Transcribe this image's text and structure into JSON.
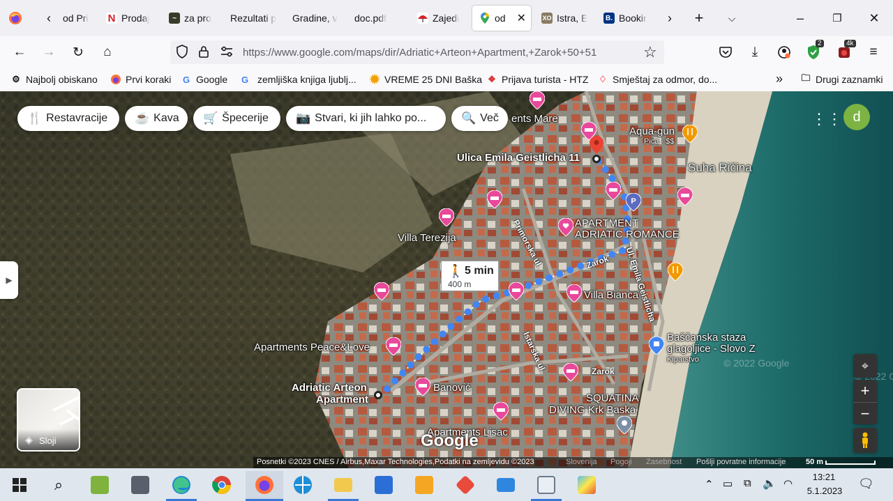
{
  "browser": {
    "tabs": [
      {
        "label": "od Pri"
      },
      {
        "label": "Prodaj"
      },
      {
        "label": "za pro"
      },
      {
        "label": "Rezultati p"
      },
      {
        "label": "Gradine, v"
      },
      {
        "label": "doc.pdf"
      },
      {
        "label": "Zajedi"
      },
      {
        "label": "od",
        "active": true
      },
      {
        "label": "Istra, E"
      },
      {
        "label": "Bookir"
      }
    ],
    "url": "https://www.google.com/maps/dir/Adriatic+Arteon+Apartment,+Zarok+50+51",
    "badges": {
      "vpn": "2",
      "ext": "4k"
    },
    "bookmarks": [
      {
        "label": "Najbolj obiskano"
      },
      {
        "label": "Prvi koraki"
      },
      {
        "label": "Google"
      },
      {
        "label": "zemljiška knjiga ljublj..."
      },
      {
        "label": "VREME 25 DNI Baška"
      },
      {
        "label": "Prijava turista - HTZ"
      },
      {
        "label": "Smještaj za odmor, do..."
      }
    ],
    "other_bookmarks": "Drugi zaznamki"
  },
  "map": {
    "chips": [
      {
        "label": "Restavracije"
      },
      {
        "label": "Kava"
      },
      {
        "label": "Špecerije"
      },
      {
        "label": "Stvari, ki jih lahko po..."
      },
      {
        "label": "Več"
      }
    ],
    "account_initial": "d",
    "route": {
      "duration": "5 min",
      "distance": "400 m"
    },
    "places": {
      "destination": "Ulica Emila Geistlicha 11",
      "origin_line1": "Adriatic Arteon",
      "origin_line2": "Apartment",
      "villa_terezija": "Villa Terezija",
      "adriatic_romance_1": "APARTMENT",
      "adriatic_romance_2": "ADRIATIC ROMANCE",
      "villa_bianca": "Villa Bianca",
      "peace_love": "Apartments Peace&Love",
      "banovic": "Banović",
      "aqua_gun": "Aqua-gun",
      "aqua_gun_sub": "Pica · $$",
      "suha_ricina": "Suha Ričina",
      "staza_1": "Baščanska staza",
      "staza_2": "glagoljice - Slovo Z",
      "staza_sub": "Kiparstvo",
      "squatina_1": "SQUATINA",
      "squatina_2": "DIVING Krk Baska",
      "lisac": "Apartments Lisac",
      "mare": "ents Mare"
    },
    "streets": {
      "primorska": "Primorska ul.",
      "zarok_1": "Zarok",
      "zarok_2": "Zarok",
      "emila": "Ul. Emila Geistlicha",
      "istarska": "Istarska ul."
    },
    "watermark": "© 2022 Google",
    "watermark2": "© 2022 Goo",
    "google_logo": "Google",
    "layers_label": "Sloji",
    "attribution": {
      "imagery": "Posnetki ©2023 CNES / Airbus,Maxar Technologies,Podatki na zemljevidu ©2023",
      "country": "Slovenija",
      "terms": "Pogoji",
      "privacy": "Zasebnost",
      "feedback": "Pošlji povratne informacije",
      "scale": "50 m"
    }
  },
  "taskbar": {
    "time": "13:21",
    "date": "5.1.2023"
  }
}
